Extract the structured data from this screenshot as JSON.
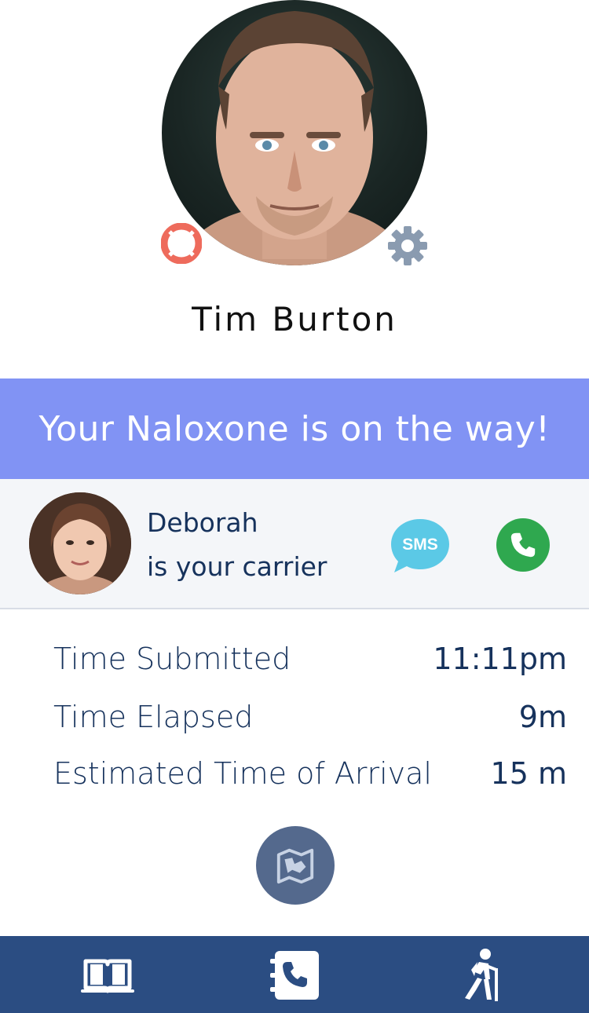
{
  "profile": {
    "name": "Tim Burton",
    "avatar_icon": "user-photo",
    "help_icon": "lifebuoy-icon",
    "settings_icon": "gear-icon"
  },
  "banner": {
    "message": "Your Naloxone is on the way!",
    "color": "#8193f4"
  },
  "carrier": {
    "name": "Deborah",
    "role": "is your carrier",
    "sms_label": "SMS",
    "sms_color": "#5bc9e6",
    "call_icon": "phone-icon",
    "call_color": "#2fa84f"
  },
  "details": {
    "rows": [
      {
        "label": "Time Submitted",
        "value": "11:11pm"
      },
      {
        "label": "Time Elapsed",
        "value": "9m"
      },
      {
        "label": "Estimated Time of Arrival",
        "value": "15 m"
      }
    ],
    "map_icon": "map-icon"
  },
  "tabbar": {
    "color": "#2b4d82",
    "tabs": [
      {
        "icon": "book-icon"
      },
      {
        "icon": "contacts-phone-icon"
      },
      {
        "icon": "hiker-icon"
      }
    ]
  }
}
